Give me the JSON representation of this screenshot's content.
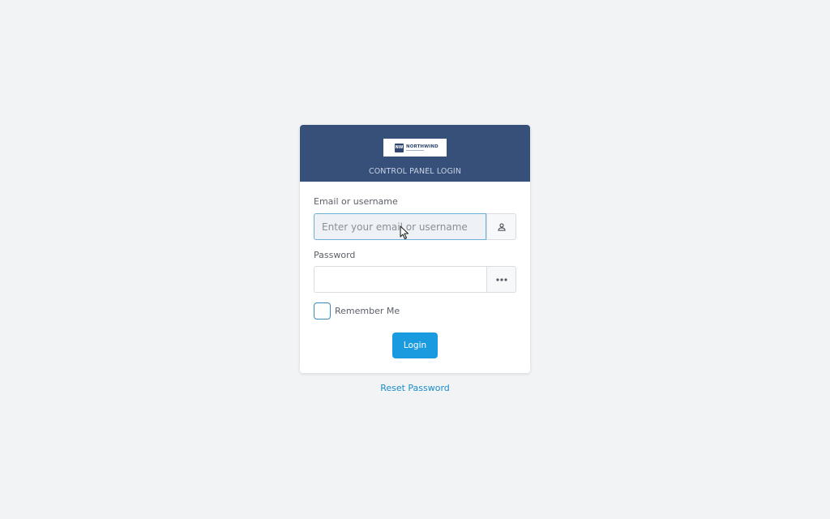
{
  "header": {
    "logo_mark": "NW",
    "logo_name": "NORTHWIND",
    "title": "CONTROL PANEL LOGIN",
    "background_color": "#36507a"
  },
  "form": {
    "email_label": "Email or username",
    "email_placeholder": "Enter your email or username",
    "email_value": "",
    "email_icon": "user-icon",
    "password_label": "Password",
    "password_placeholder": "",
    "password_value": "",
    "password_icon": "password-dots-icon",
    "remember_label": "Remember Me",
    "remember_checked": false,
    "login_label": "Login",
    "accent_color": "#1a9be0"
  },
  "footer": {
    "reset_label": "Reset Password"
  }
}
